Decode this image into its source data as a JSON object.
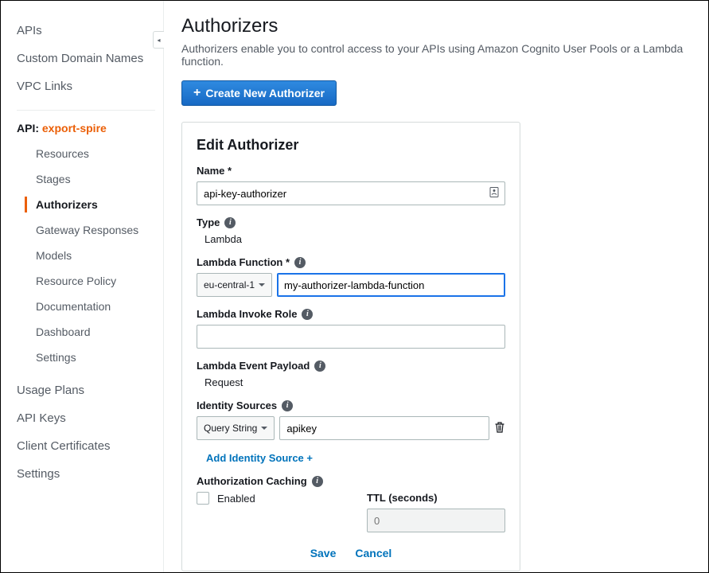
{
  "sidebar": {
    "top": [
      "APIs",
      "Custom Domain Names",
      "VPC Links"
    ],
    "api_label_prefix": "API: ",
    "api_name": "export-spire",
    "sub": [
      "Resources",
      "Stages",
      "Authorizers",
      "Gateway Responses",
      "Models",
      "Resource Policy",
      "Documentation",
      "Dashboard",
      "Settings"
    ],
    "active_sub": "Authorizers",
    "bottom": [
      "Usage Plans",
      "API Keys",
      "Client Certificates",
      "Settings"
    ]
  },
  "header": {
    "title": "Authorizers",
    "desc": "Authorizers enable you to control access to your APIs using Amazon Cognito User Pools or a Lambda function.",
    "create_btn": "Create New Authorizer"
  },
  "panel": {
    "title": "Edit Authorizer",
    "name_label": "Name *",
    "name_value": "api-key-authorizer",
    "type_label": "Type",
    "type_value": "Lambda",
    "lambda_fn_label": "Lambda Function *",
    "lambda_region": "eu-central-1",
    "lambda_fn_value": "my-authorizer-lambda-function",
    "invoke_role_label": "Lambda Invoke Role",
    "invoke_role_value": "",
    "payload_label": "Lambda Event Payload",
    "payload_value": "Request",
    "identity_label": "Identity Sources",
    "identity_type": "Query String",
    "identity_key": "apikey",
    "add_identity": "Add Identity Source +",
    "caching_label": "Authorization Caching",
    "caching_enabled_label": "Enabled",
    "ttl_label": "TTL (seconds)",
    "ttl_placeholder": "0",
    "save": "Save",
    "cancel": "Cancel"
  }
}
